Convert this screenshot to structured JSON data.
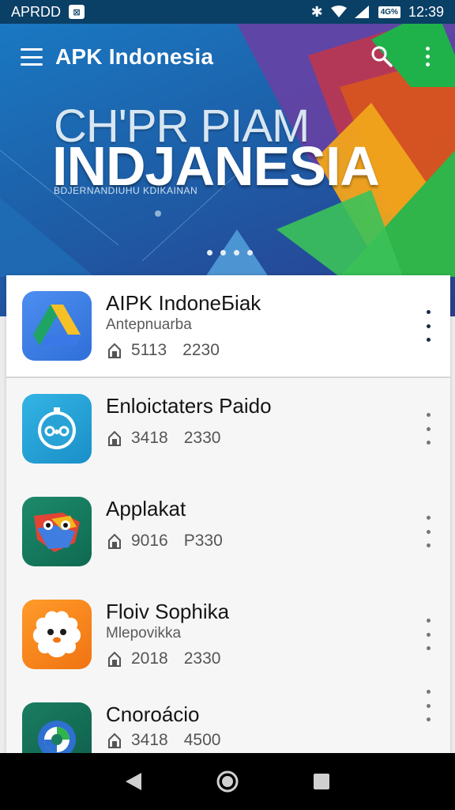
{
  "status_bar": {
    "carrier": "APRDD",
    "notification_icon": "notification-icon",
    "battery_label": "4G%",
    "time": "12:39"
  },
  "toolbar": {
    "title": "APK Indonesia",
    "search_icon": "search-icon",
    "more_icon": "more-vertical-icon"
  },
  "banner": {
    "line1": "CH'PR PIAM",
    "line2": "INDJANESIA",
    "subtitle": "BDJERNANDIUHU KDIKAINAN",
    "accent_colors": [
      "#7a3aa0",
      "#d8421f",
      "#2ec24a",
      "#f2b41c"
    ]
  },
  "apps": [
    {
      "name": "AIPK IndoneБiak",
      "publisher": "Antepnuarba",
      "stat1": "5113",
      "stat2": "2230",
      "icon": "drive-icon"
    },
    {
      "name": "Enloictaters Paido",
      "publisher": "",
      "stat1": "3418",
      "stat2": "2330",
      "icon": "timer-face-icon"
    },
    {
      "name": "Apрlakat",
      "publisher": "",
      "stat1": "9016",
      "stat2": "P330",
      "icon": "parrot-icon"
    },
    {
      "name": "Floiv Sophika",
      "publisher": "Mlepovikka",
      "stat1": "2018",
      "stat2": "2330",
      "icon": "fluffy-creature-icon"
    },
    {
      "name": "Cnorоácio",
      "publisher": "",
      "stat1": "3418",
      "stat2": "4500",
      "icon": "swirl-icon"
    }
  ],
  "navbar": {
    "back_icon": "back-icon",
    "home_icon": "home-icon",
    "recents_icon": "recents-icon"
  }
}
